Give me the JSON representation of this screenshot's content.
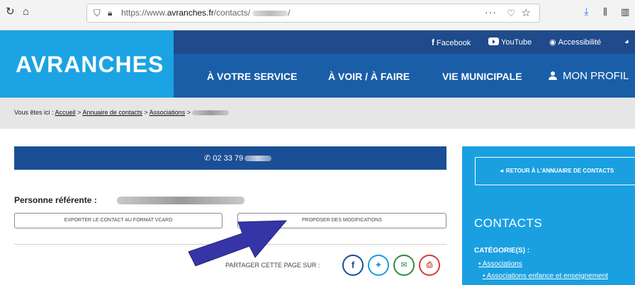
{
  "browser": {
    "url_prefix": "https://www.",
    "url_domain": "avranches.fr",
    "url_path": "/contacts/",
    "url_suffix": "/",
    "menu_dots": "···",
    "icons": [
      "back-icon",
      "home-icon",
      "shield-icon",
      "lock-icon",
      "pocket-icon",
      "star-icon",
      "download-icon",
      "library-icon",
      "sidebar-icon"
    ]
  },
  "header": {
    "logo": "AVRANCHES",
    "social": [
      {
        "icon": "facebook-icon",
        "label": "Facebook"
      },
      {
        "icon": "youtube-icon",
        "label": "YouTube"
      },
      {
        "icon": "eye-icon",
        "label": "Accessibilité"
      }
    ],
    "nav": [
      {
        "label": "À VOTRE SERVICE"
      },
      {
        "label": "À VOIR / À FAIRE"
      },
      {
        "label": "VIE MUNICIPALE"
      },
      {
        "label": "MON PROFIL",
        "icon": "person-icon"
      }
    ],
    "colors": {
      "logo_bg": "#1ca3e3",
      "nav_bg": "#1a5ea8",
      "topbar_bg": "#1f4a8b"
    }
  },
  "breadcrumb": {
    "prefix": "Vous êtes ici : ",
    "items": [
      "Accueil",
      "Annuaire de contacts",
      "Associations"
    ],
    "separator": " > "
  },
  "contact": {
    "phone": "02 33 79",
    "referent_label": "Personne référente :",
    "export_button": "EXPORTER LE CONTACT AU FORMAT VCARD",
    "modify_button": "PROPOSER DES MODIFICATIONS",
    "share_label": "PARTAGER CETTE PAGE SUR :",
    "share_icons": [
      "facebook-icon",
      "twitter-icon",
      "mail-icon",
      "print-icon"
    ]
  },
  "sidebar": {
    "back_label": "◄  RETOUR À L'ANNUAIRE DE CONTACTS",
    "title": "CONTACTS",
    "category_label": "CATÉGORIE(S) :",
    "links": [
      "Associations",
      "Associations enfance et enseignement"
    ],
    "color": "#1aa0e1"
  }
}
